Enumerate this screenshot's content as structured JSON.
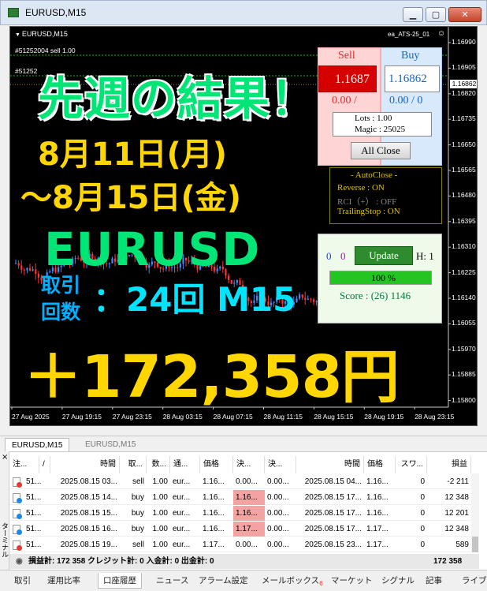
{
  "window": {
    "title": "EURUSD,M15",
    "min": "▁",
    "max": "▢",
    "close": "✕",
    "icon": "chart-window-icon"
  },
  "chart": {
    "symbol_label": "EURUSD,M15",
    "ea_label": "ea_ATS-25_01",
    "smiley": "☺",
    "line1_label": "#51252004 sell 1.00",
    "line2_label": "#51252",
    "current_price": "1.16862",
    "price_ticks": [
      "1.16990",
      "1.16905",
      "1.16820",
      "1.16735",
      "1.16650",
      "1.16565",
      "1.16480",
      "1.16395",
      "1.16310",
      "1.16225",
      "1.16140",
      "1.16055",
      "1.15970",
      "1.15885",
      "1.15800"
    ],
    "time_ticks": [
      "27 Aug 2025",
      "27 Aug 19:15",
      "27 Aug 23:15",
      "28 Aug 03:15",
      "28 Aug 07:15",
      "28 Aug 11:15",
      "28 Aug 15:15",
      "28 Aug 19:15",
      "28 Aug 23:15"
    ],
    "colors": {
      "bull": "#3f8cff",
      "bear": "#ff3333",
      "background": "#000000"
    }
  },
  "overlay": {
    "headline": "先週の結果！",
    "date_line1": "8月11日(月)",
    "date_line2": "〜8月15日(金)",
    "pair": "EURUSD",
    "trades_label_top": "取引",
    "trades_label_bottom": "回数",
    "trades_value": "：24回 M15",
    "profit": "＋172,358円"
  },
  "ea_panel": {
    "sell_label": "Sell",
    "buy_label": "Buy",
    "sell_price": "1.1687",
    "buy_price": "1.16862",
    "sell_pl": "0.00 /",
    "buy_pl": "0.00 / 0",
    "lots": "Lots   : 1.00",
    "magic": "Magic : 25025",
    "all_close": "All Close",
    "autoclose_title": "- AutoClose -",
    "reverse": "Reverse      : ON",
    "rci": "RCI（+）    : OFF",
    "trailing": "TrailingStop : ON",
    "count_left": "0",
    "count_right": "0",
    "update": "Update",
    "h_label": "H: 1",
    "progress_text": "100 %",
    "progress": 1.0,
    "score": "Score : (26) 1146"
  },
  "chart_tabs": [
    "EURUSD,M15",
    "EURUSD,M15"
  ],
  "terminal": {
    "side_label": "ターミナル",
    "close_x": "×",
    "headers": [
      "注...",
      "/",
      "時間",
      "取...",
      "数...",
      "通...",
      "価格",
      "決...",
      "決...",
      "時間",
      "価格",
      "スワ...",
      "損益"
    ],
    "rows": [
      {
        "ticket": "51...",
        "open_time": "2025.08.15 03...",
        "type": "sell",
        "size": "1.00",
        "symbol": "eur...",
        "price": "1.16...",
        "sl": "0.00...",
        "tp": "0.00...",
        "close_time": "2025.08.15 04...",
        "close_price": "1.16...",
        "swap": "0",
        "profit": "-2 211",
        "sl_hit": false
      },
      {
        "ticket": "51...",
        "open_time": "2025.08.15 14...",
        "type": "buy",
        "size": "1.00",
        "symbol": "eur...",
        "price": "1.16...",
        "sl": "1.16...",
        "tp": "0.00...",
        "close_time": "2025.08.15 17...",
        "close_price": "1.16...",
        "swap": "0",
        "profit": "12 348",
        "sl_hit": true
      },
      {
        "ticket": "51...",
        "open_time": "2025.08.15 15...",
        "type": "buy",
        "size": "1.00",
        "symbol": "eur...",
        "price": "1.16...",
        "sl": "1.16...",
        "tp": "0.00...",
        "close_time": "2025.08.15 17...",
        "close_price": "1.16...",
        "swap": "0",
        "profit": "12 201",
        "sl_hit": true
      },
      {
        "ticket": "51...",
        "open_time": "2025.08.15 16...",
        "type": "buy",
        "size": "1.00",
        "symbol": "eur...",
        "price": "1.16...",
        "sl": "1.17...",
        "tp": "0.00...",
        "close_time": "2025.08.15 17...",
        "close_price": "1.17...",
        "swap": "0",
        "profit": "12 348",
        "sl_hit": true
      },
      {
        "ticket": "51...",
        "open_time": "2025.08.15 19...",
        "type": "sell",
        "size": "1.00",
        "symbol": "eur...",
        "price": "1.17...",
        "sl": "0.00...",
        "tp": "0.00...",
        "close_time": "2025.08.15 23...",
        "close_price": "1.17...",
        "swap": "0",
        "profit": "589",
        "sl_hit": false
      }
    ],
    "summary": "損益計: 172 358  クレジット計: 0  入金計: 0  出金計: 0",
    "summary_total": "172 358",
    "tabs": [
      "取引",
      "運用比率",
      "口座履歴",
      "ニュース",
      "アラーム設定",
      "メールボックス",
      "マーケット",
      "シグナル",
      "記事",
      "ライブ"
    ],
    "mailbox_badge": "6",
    "active_tab": "口座履歴"
  }
}
